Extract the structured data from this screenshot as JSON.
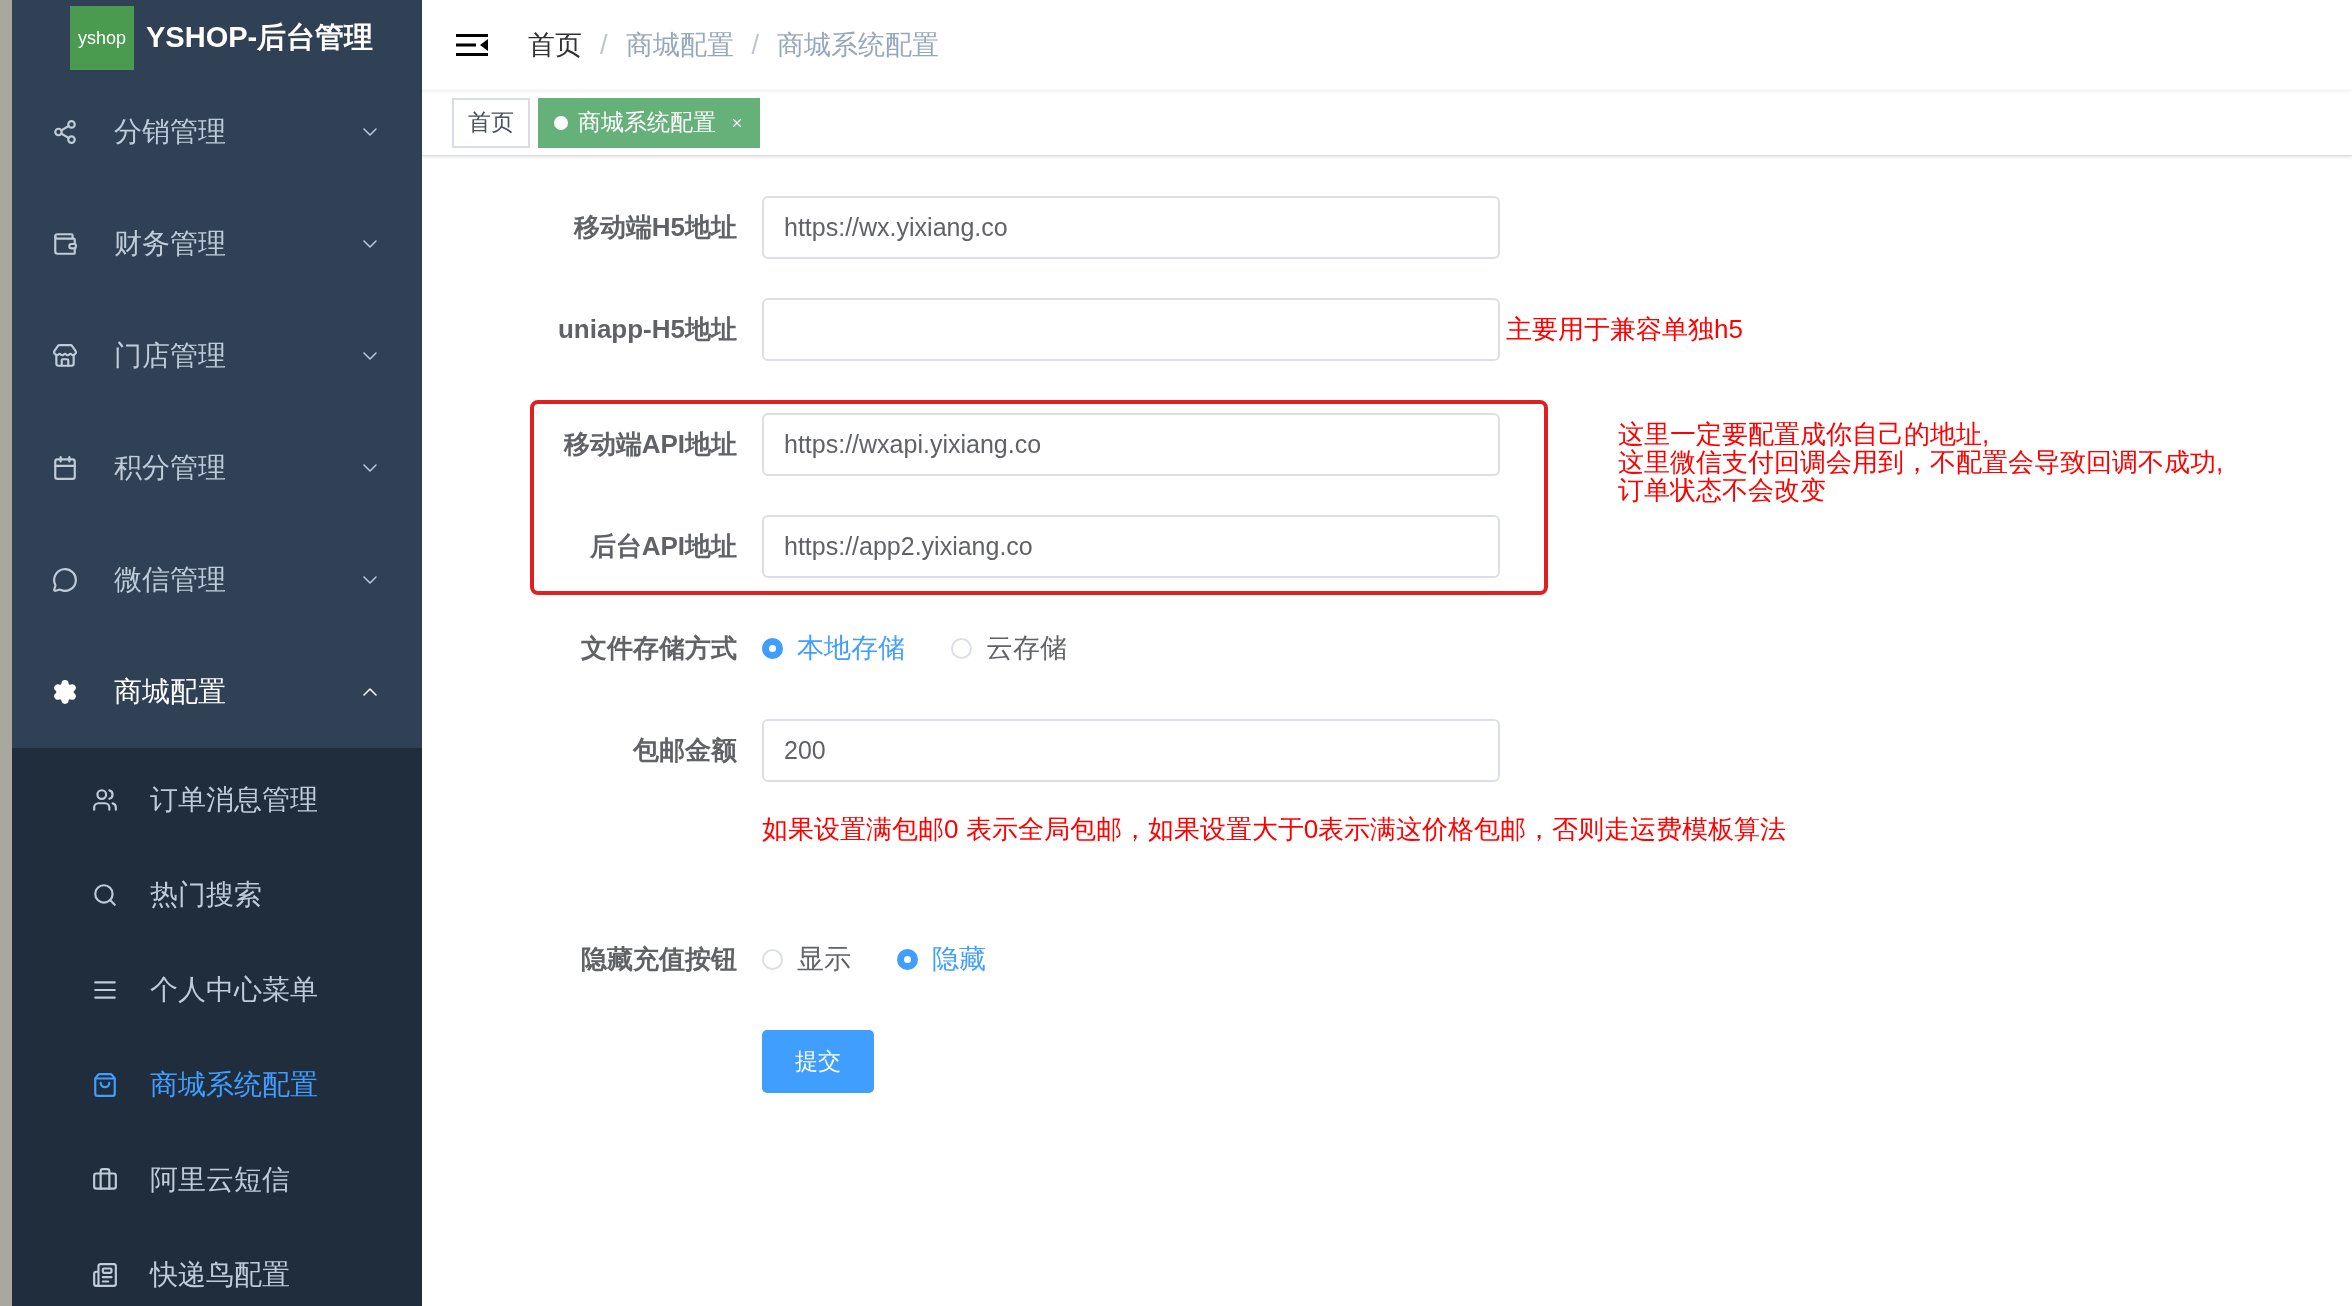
{
  "sidebar": {
    "logo_text": "yshop",
    "title": "YSHOP-后台管理",
    "menus": [
      {
        "label": "分销管理",
        "expanded": false
      },
      {
        "label": "财务管理",
        "expanded": false
      },
      {
        "label": "门店管理",
        "expanded": false
      },
      {
        "label": "积分管理",
        "expanded": false
      },
      {
        "label": "微信管理",
        "expanded": false
      },
      {
        "label": "商城配置",
        "expanded": true,
        "children": [
          {
            "label": "订单消息管理",
            "selected": false
          },
          {
            "label": "热门搜索",
            "selected": false
          },
          {
            "label": "个人中心菜单",
            "selected": false
          },
          {
            "label": "商城系统配置",
            "selected": true
          },
          {
            "label": "阿里云短信",
            "selected": false
          },
          {
            "label": "快递鸟配置",
            "selected": false
          }
        ]
      }
    ]
  },
  "breadcrumb": [
    {
      "label": "首页",
      "current": false
    },
    {
      "label": "商城配置",
      "current": true,
      "separator": "/"
    },
    {
      "label": "商城系统配置",
      "current": true,
      "separator": "/"
    }
  ],
  "tags": [
    {
      "label": "首页",
      "selected": false,
      "closable": false
    },
    {
      "label": "商城系统配置",
      "selected": true,
      "closable": true
    }
  ],
  "form": {
    "rows": [
      {
        "kind": "input",
        "label": "移动端H5地址",
        "value": "https://wx.yixiang.co"
      },
      {
        "kind": "input",
        "label": "uniapp-H5地址",
        "note": "主要用于兼容单独h5"
      },
      {
        "kind": "group",
        "note_lines": [
          "这里一定要配置成你自己的地址,",
          "这里微信支付回调会用到，不配置会导致回调不成功,",
          "订单状态不会改变"
        ],
        "rows": [
          {
            "kind": "input",
            "label": "移动端API地址",
            "value": "https://wxapi.yixiang.co"
          },
          {
            "kind": "input",
            "label": "后台API地址",
            "value": "https://app2.yixiang.co"
          }
        ]
      },
      {
        "kind": "radio",
        "label": "文件存储方式",
        "options": [
          {
            "label": "本地存储",
            "selected": true
          },
          {
            "label": "云存储",
            "selected": false
          }
        ]
      },
      {
        "kind": "input",
        "label": "包邮金额",
        "value": "200",
        "hint": "如果设置满包邮0 表示全局包邮，如果设置大于0表示满这价格包邮，否则走运费模板算法"
      },
      {
        "kind": "radio",
        "label": "隐藏充值按钮",
        "options": [
          {
            "label": "显示",
            "selected": false
          },
          {
            "label": "隐藏",
            "selected": true
          }
        ]
      }
    ],
    "submit": "提交"
  }
}
